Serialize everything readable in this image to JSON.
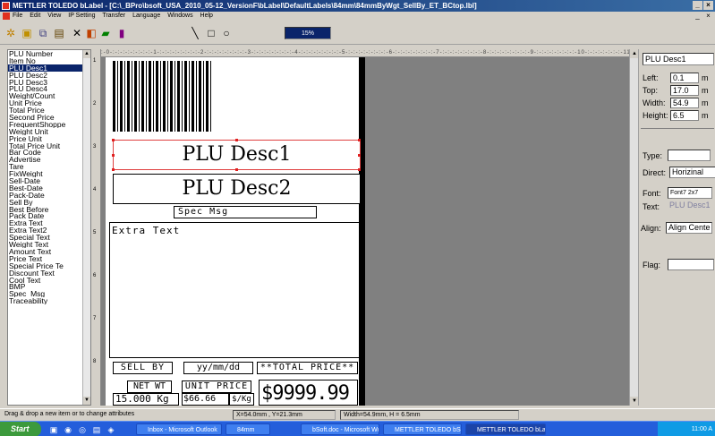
{
  "window": {
    "title": "METTLER TOLEDO bLabel - [C:\\_BPro\\bsoft_USA_2010_05-12_VersionF\\bLabel\\DefaultLabels\\84mm\\84mmByWgt_SellBy_ET_BCtop.lbl]"
  },
  "menu": {
    "items": [
      "File",
      "Edit",
      "View",
      "IP Setting",
      "Transfer",
      "Language",
      "Windows",
      "Help"
    ]
  },
  "toolbar": {
    "zoom": "15%"
  },
  "field_list": {
    "items": [
      "PLU Number",
      "Item No",
      "PLU Desc1",
      "PLU Desc2",
      "PLU Desc3",
      "PLU Desc4",
      "Weight/Count",
      "Unit Price",
      "Total Price",
      "Second Price",
      "FrequentShoppe",
      "Weight Unit",
      "Price Unit",
      "Total Price Unit",
      "Bar Code",
      "Advertise",
      "Tare",
      "FixWeight",
      "Sell-Date",
      "Best-Date",
      "Pack-Date",
      "Sell By",
      "Best Before",
      "Pack Date",
      "Extra Text",
      "Extra Text2",
      "Special Text",
      "Weight Text",
      "Amount Text",
      "Price Text",
      "Special Price Te",
      "Discount Text",
      "Cool Text",
      "BMP",
      "Spec_Msg",
      "Traceability"
    ],
    "selected": "PLU Desc1"
  },
  "ruler": {
    "h": ":-0-:-:-:-:-:-:-:-:-1-:-:-:-:-:-:-:-:-2-:-:-:-:-:-:-:-:-3-:-:-:-:-:-:-:-:-4-:-:-:-:-:-:-:-:-5-:-:-:-:-:-:-:-:-6-:-:-:-:-:-:-:-:-7-:-:-:-:-:-:-:-:-8-:-:-:-:-:-:-:-:-9-:-:-:-:-:-:-:-:-10-:-:-:-:-:-:-:-11-:-:-",
    "v": [
      "1",
      "2",
      "3",
      "4",
      "5",
      "6",
      "7",
      "8"
    ]
  },
  "label": {
    "plu_desc1": "PLU Desc1",
    "plu_desc2": "PLU Desc2",
    "spec_msg": "Spec Msg",
    "extra_text": "Extra Text",
    "sell_by": "SELL BY",
    "date": "yy/mm/dd",
    "total_price_label": "**TOTAL PRICE**",
    "net_wt": "NET WT",
    "unit_price_label": "UNIT PRICE",
    "weight_value": "15.000 Kg",
    "unit_price_value": "$66.66",
    "per_kg": "$/Kg",
    "total_price_value": "$9999.99"
  },
  "properties": {
    "selected_object": "PLU Desc1",
    "left_label": "Left:",
    "left": "0.1",
    "top_label": "Top:",
    "top": "17.0",
    "width_label": "Width:",
    "width": "54.9",
    "height_label": "Height:",
    "height": "6.5",
    "unit": "m",
    "type_label": "Type:",
    "type": "",
    "direct_label": "Direct:",
    "direct": "Horizinal",
    "font_label": "Font:",
    "font": "Font7 2x7",
    "text_label": "Text:",
    "text": "PLU Desc1",
    "align_label": "Align:",
    "align": "Align Cente",
    "flag_label": "Flag:",
    "flag": ""
  },
  "status": {
    "hint": "Drag & drop a new item or to change attributes",
    "position": "X=54.0mm , Y=21.3mm",
    "size": "Width=54.9mm, H = 6.5mm"
  },
  "taskbar": {
    "start": "Start",
    "tasks": [
      "Inbox - Microsoft Outlook",
      "84mm",
      "bSoft.doc - Microsoft Word",
      "METTLER TOLEDO bSoft",
      "METTLER TOLEDO bLa..."
    ],
    "clock": "11:00 A"
  }
}
